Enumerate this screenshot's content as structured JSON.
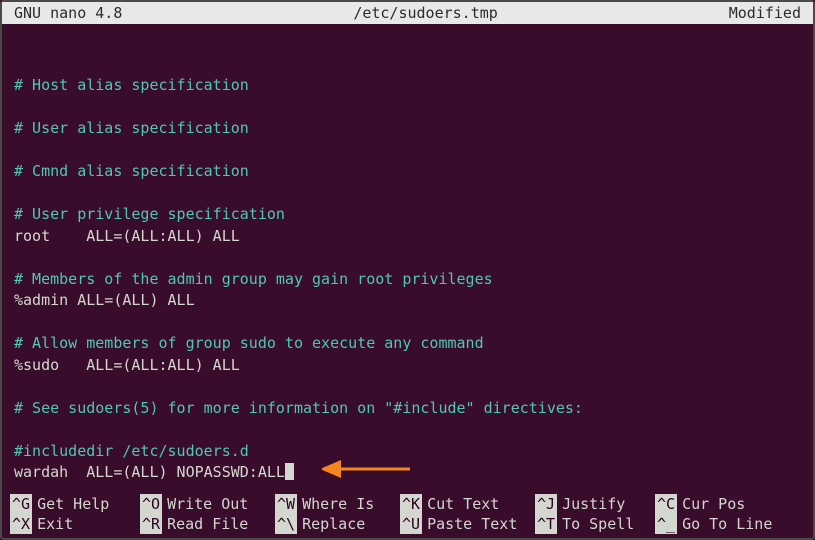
{
  "title_bar": {
    "left": "GNU nano 4.8",
    "center": "/etc/sudoers.tmp",
    "right": "Modified"
  },
  "lines": [
    {
      "type": "blank",
      "text": ""
    },
    {
      "type": "comment",
      "text": "# Host alias specification"
    },
    {
      "type": "blank",
      "text": ""
    },
    {
      "type": "comment",
      "text": "# User alias specification"
    },
    {
      "type": "blank",
      "text": ""
    },
    {
      "type": "comment",
      "text": "# Cmnd alias specification"
    },
    {
      "type": "blank",
      "text": ""
    },
    {
      "type": "comment",
      "text": "# User privilege specification"
    },
    {
      "type": "plain",
      "text": "root    ALL=(ALL:ALL) ALL"
    },
    {
      "type": "blank",
      "text": ""
    },
    {
      "type": "comment",
      "text": "# Members of the admin group may gain root privileges"
    },
    {
      "type": "plain",
      "text": "%admin ALL=(ALL) ALL"
    },
    {
      "type": "blank",
      "text": ""
    },
    {
      "type": "comment",
      "text": "# Allow members of group sudo to execute any command"
    },
    {
      "type": "plain",
      "text": "%sudo   ALL=(ALL:ALL) ALL"
    },
    {
      "type": "blank",
      "text": ""
    },
    {
      "type": "comment",
      "text": "# See sudoers(5) for more information on \"#include\" directives:"
    },
    {
      "type": "blank",
      "text": ""
    },
    {
      "type": "comment",
      "text": "#includedir /etc/sudoers.d"
    },
    {
      "type": "plain_cursor",
      "text": "wardah  ALL=(ALL) NOPASSWD:ALL"
    }
  ],
  "shortcuts_row1": [
    {
      "key": "^G",
      "label": "Get Help"
    },
    {
      "key": "^O",
      "label": "Write Out"
    },
    {
      "key": "^W",
      "label": "Where Is"
    },
    {
      "key": "^K",
      "label": "Cut Text"
    },
    {
      "key": "^J",
      "label": "Justify"
    },
    {
      "key": "^C",
      "label": "Cur Pos"
    }
  ],
  "shortcuts_row2": [
    {
      "key": "^X",
      "label": "Exit"
    },
    {
      "key": "^R",
      "label": "Read File"
    },
    {
      "key": "^\\",
      "label": "Replace"
    },
    {
      "key": "^U",
      "label": "Paste Text"
    },
    {
      "key": "^T",
      "label": "To Spell"
    },
    {
      "key": "^_",
      "label": "Go To Line"
    }
  ],
  "annotation": {
    "type": "arrow",
    "color": "#F5871F"
  }
}
